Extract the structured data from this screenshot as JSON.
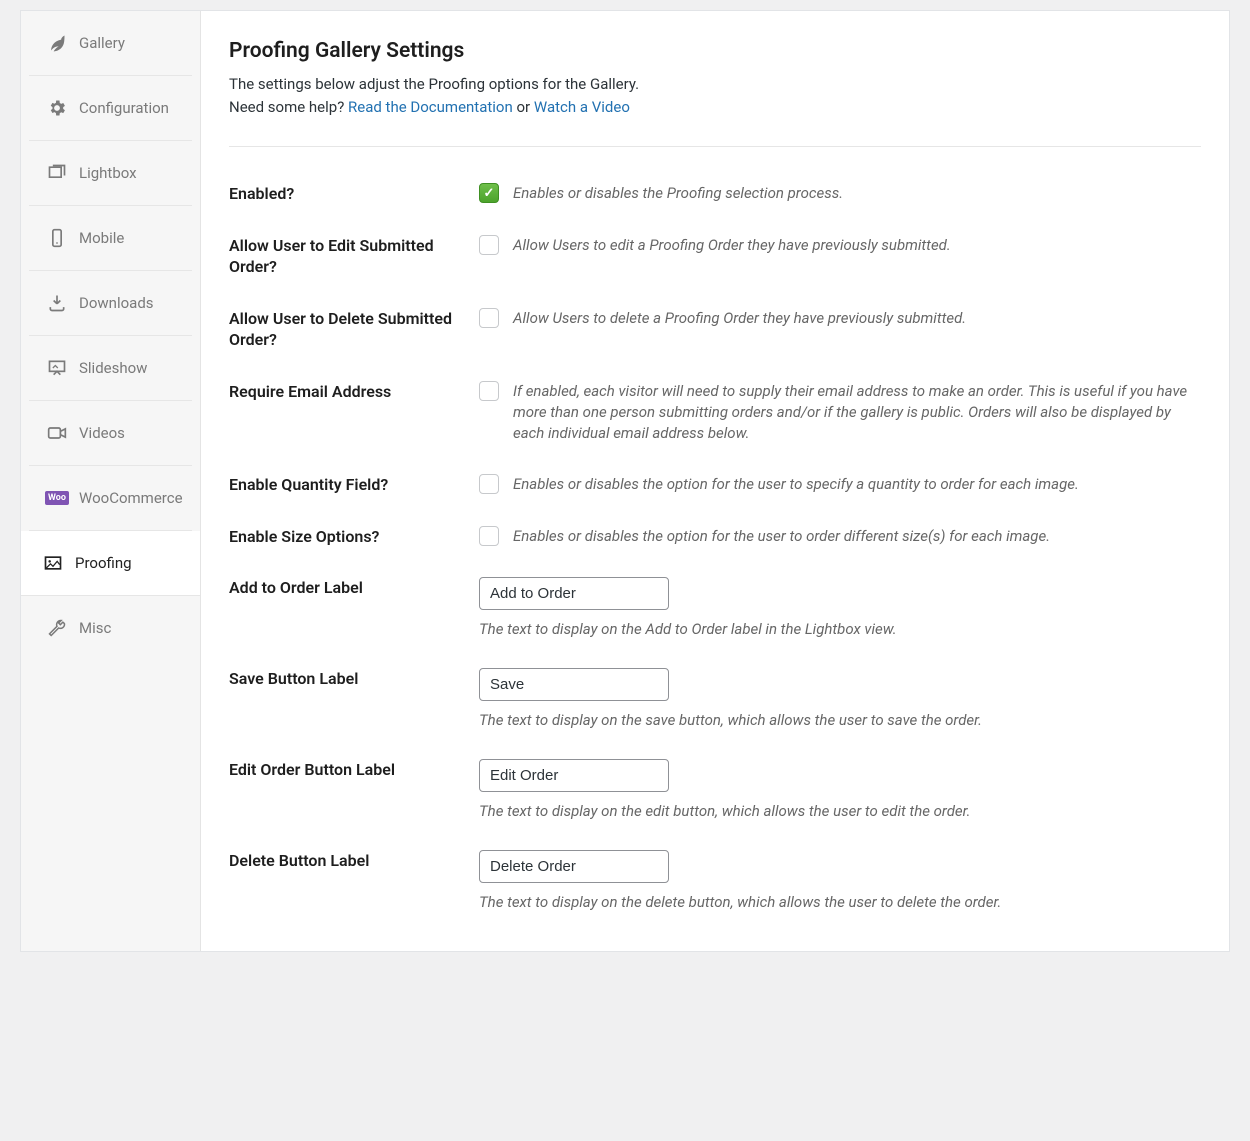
{
  "sidebar": {
    "items": [
      {
        "label": "Gallery"
      },
      {
        "label": "Configuration"
      },
      {
        "label": "Lightbox"
      },
      {
        "label": "Mobile"
      },
      {
        "label": "Downloads"
      },
      {
        "label": "Slideshow"
      },
      {
        "label": "Videos"
      },
      {
        "label": "WooCommerce"
      },
      {
        "label": "Proofing"
      },
      {
        "label": "Misc"
      }
    ]
  },
  "header": {
    "title": "Proofing Gallery Settings",
    "sub1": "The settings below adjust the Proofing options for the Gallery.",
    "sub2_pre": "Need some help? ",
    "sub2_link1": "Read the Documentation",
    "sub2_or": " or ",
    "sub2_link2": "Watch a Video"
  },
  "fields": {
    "enabled": {
      "label": "Enabled?",
      "desc": "Enables or disables the Proofing selection process."
    },
    "allow_edit": {
      "label": "Allow User to Edit Submitted Order?",
      "desc": "Allow Users to edit a Proofing Order they have previously submitted."
    },
    "allow_delete": {
      "label": "Allow User to Delete Submitted Order?",
      "desc": "Allow Users to delete a Proofing Order they have previously submitted."
    },
    "require_email": {
      "label": "Require Email Address",
      "desc": "If enabled, each visitor will need to supply their email address to make an order. This is useful if you have more than one person submitting orders and/or if the gallery is public. Orders will also be displayed by each individual email address below."
    },
    "enable_qty": {
      "label": "Enable Quantity Field?",
      "desc": "Enables or disables the option for the user to specify a quantity to order for each image."
    },
    "enable_size": {
      "label": "Enable Size Options?",
      "desc": "Enables or disables the option for the user to order different size(s) for each image."
    },
    "add_label": {
      "label": "Add to Order Label",
      "value": "Add to Order",
      "desc": "The text to display on the Add to Order label in the Lightbox view."
    },
    "save_label": {
      "label": "Save Button Label",
      "value": "Save",
      "desc": "The text to display on the save button, which allows the user to save the order."
    },
    "edit_label": {
      "label": "Edit Order Button Label",
      "value": "Edit Order",
      "desc": "The text to display on the edit button, which allows the user to edit the order."
    },
    "delete_label": {
      "label": "Delete Button Label",
      "value": "Delete Order",
      "desc": "The text to display on the delete button, which allows the user to delete the order."
    }
  }
}
